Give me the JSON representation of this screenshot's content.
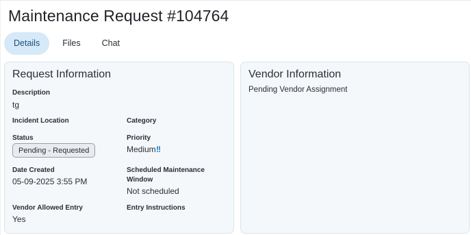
{
  "page": {
    "title": "Maintenance Request #104764"
  },
  "tabs": [
    {
      "label": "Details",
      "active": true
    },
    {
      "label": "Files",
      "active": false
    },
    {
      "label": "Chat",
      "active": false
    }
  ],
  "request_info": {
    "title": "Request Information",
    "description_label": "Description",
    "description_value": "tg",
    "incident_location_label": "Incident Location",
    "incident_location_value": "",
    "category_label": "Category",
    "category_value": "",
    "status_label": "Status",
    "status_value": "Pending - Requested",
    "priority_label": "Priority",
    "priority_value": "Medium",
    "priority_icon": "!!",
    "date_created_label": "Date Created",
    "date_created_value": "05-09-2025 3:55 PM",
    "scheduled_label": "Scheduled Maintenance Window",
    "scheduled_value": "Not scheduled",
    "vendor_entry_label": "Vendor Allowed Entry",
    "vendor_entry_value": "Yes",
    "entry_instructions_label": "Entry Instructions",
    "entry_instructions_value": ""
  },
  "vendor_info": {
    "title": "Vendor Information",
    "status_text": "Pending Vendor Assignment"
  },
  "colors": {
    "tab_active_bg": "#d6e9f8",
    "card_bg": "#f4f8fb",
    "card_border": "#d9e4ee",
    "priority_icon": "#1d78c7",
    "badge_bg": "#e9ebee",
    "badge_border": "#9aa0a6"
  }
}
